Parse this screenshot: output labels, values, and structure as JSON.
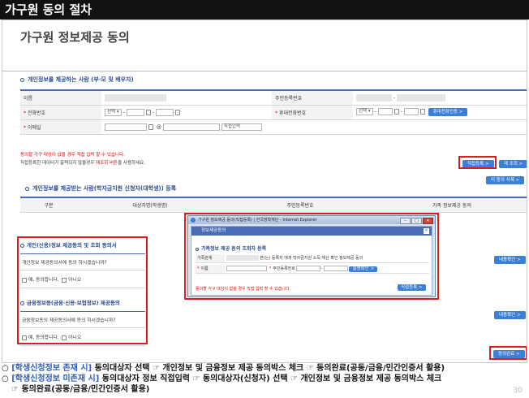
{
  "slide": {
    "title": "가구원 동의 절차",
    "page_number": "30"
  },
  "screen": {
    "page_title": "가구원 정보제공 동의",
    "provider_section": {
      "title": "개인정보를 제공하는 사람 (부·모 및 배우자)",
      "rows": {
        "name_label": "이름",
        "rrn_label": "주민등록번호",
        "phone_label": "전화번호",
        "phone_select": "선택",
        "mobile_label": "휴대전화번호",
        "mobile_select": "선택",
        "mobile_auth_button": "휴대전화인증 >",
        "email_label": "이메일",
        "email_at": "@",
        "email_domain_select": "직접입력"
      },
      "note_line1": "동의할 가구 대상이 없을 경우 직접 입력 할 수 있습니다.",
      "note_line2_prefix": "직접등록한 데이터가 출력되지 않을경우 ",
      "note_line2_red": "재조회 버튼",
      "note_line2_suffix": "을 사용하세요.",
      "direct_register_button": "직접등록 >",
      "requery_button": "재 조회 >",
      "delete_button": "미 동의 삭제 >"
    },
    "receiver_section": {
      "title": "개인정보를 제공받는 사람(학자금지원 신청자(대학생)) 등록",
      "columns": [
        "구분",
        "대상자명(학생명)",
        "주민등록번호",
        "가족 정보제공 동의"
      ]
    },
    "consent_personal": {
      "title": "개인(신용)정보 제공동의 및 조회 동의서",
      "question": "개인정보 제공동의서에 동의 하시겠습니까?",
      "agree": "예, 동의합니다.",
      "disagree": "아니오",
      "view_button": "내용확인 >"
    },
    "consent_finance": {
      "title": "금융정보등(금융·신용·보험정보) 제공동의",
      "question": "금융정보동의 제공동의서에 동의 하시겠습니까?",
      "agree": "예, 동의합니다.",
      "disagree": "아니오",
      "view_button": "내용확인 >"
    },
    "complete_button": "동의완료 >",
    "popup": {
      "window_title": "가구원 정보제공 동의(직접등록) | 한국장학재단 - Internet Explorer",
      "header": "정보제공동의",
      "section_title": "가족정보 제공 동의 조회자 등록",
      "relation_label": "가족관계",
      "relation_text": "본(는) 등록자 에게 학자금지원 소득·재산 확인 정보제공 동의",
      "name_label": "이름",
      "rrn_label": "주민등록번호",
      "auth_button": "실명확인 >",
      "note": "동의할 가구 대상이 없을 경우 직접 입력 할 수 있습니다.",
      "register_button": "직접등록 >"
    }
  },
  "instructions": [
    {
      "bullet": "○",
      "highlight": "[학생신청정보 존재 시]",
      "text": " 동의대상자 선택 ☞ 개인정보 및 금융정보 제공 동의박스 체크 ☞ 동의완료(공동/금융/민간인증서 활용)"
    },
    {
      "bullet": "○",
      "highlight": "[학생신청정보 미존재 시]",
      "text": " 동의대상자 정보 직접입력 ☞ 동의대상자(신청자) 선택 ☞ 개인정보 및 금융정보 제공 동의박스 체크",
      "continuation": "☞ 동의완료(공동/금융/민간인증서 활용)"
    }
  ],
  "colors": {
    "highlight_red": "#e01b1b",
    "accent_blue": "#3b7fd6",
    "section_blue": "#2a4d8f"
  }
}
